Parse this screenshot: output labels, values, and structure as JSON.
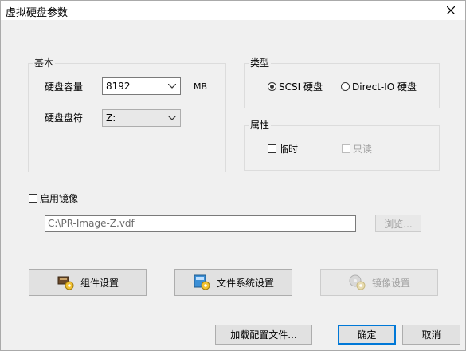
{
  "window": {
    "title": "虚拟硬盘参数"
  },
  "basic": {
    "legend": "基本",
    "capacity_label": "硬盘容量",
    "capacity_value": "8192",
    "capacity_unit": "MB",
    "drive_letter_label": "硬盘盘符",
    "drive_letter_value": "Z:"
  },
  "type": {
    "legend": "类型",
    "option_scsi": "SCSI 硬盘",
    "option_directio": "Direct-IO 硬盘",
    "selected": "SCSI 硬盘"
  },
  "attributes": {
    "legend": "属性",
    "temporary_label": "临时",
    "readonly_label": "只读"
  },
  "image": {
    "enable_label": "启用镜像",
    "path_value": "C:\\PR-Image-Z.vdf",
    "browse_label": "浏览..."
  },
  "actions": {
    "component_settings": "组件设置",
    "filesystem_settings": "文件系统设置",
    "image_settings": "镜像设置"
  },
  "footer": {
    "load_config": "加载配置文件...",
    "ok": "确定",
    "cancel": "取消"
  },
  "icons": {
    "close": "close-icon",
    "component": "component-gear-icon",
    "filesystem": "filesystem-gear-icon",
    "image": "image-gear-icon",
    "dropdown": "chevron-down-icon"
  },
  "colors": {
    "accent": "#0078d7",
    "background": "#f0f0f0"
  }
}
